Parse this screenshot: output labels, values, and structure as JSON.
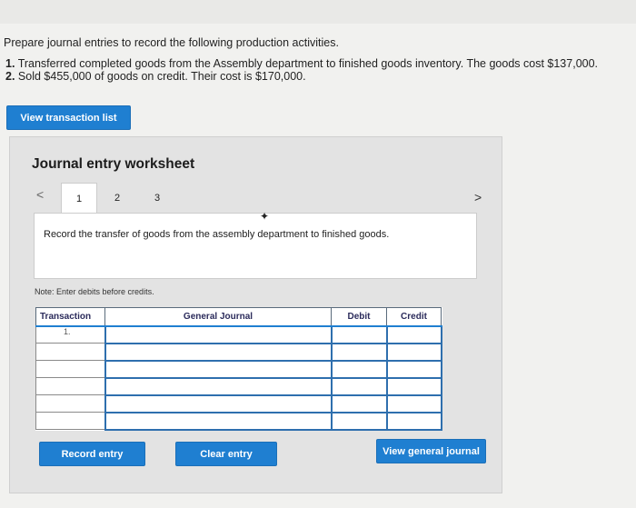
{
  "prompt": "Prepare journal entries to record the following production activities.",
  "items": [
    {
      "num": "1.",
      "text": "Transferred completed goods from the Assembly department to finished goods inventory. The goods cost $137,000."
    },
    {
      "num": "2.",
      "text": "Sold $455,000 of goods on credit. Their cost is $170,000."
    }
  ],
  "buttons": {
    "view_transaction_list": "View transaction list",
    "record_entry": "Record entry",
    "clear_entry": "Clear entry",
    "view_general_journal": "View general journal"
  },
  "worksheet": {
    "title": "Journal entry worksheet",
    "nav_prev": "<",
    "nav_next": ">",
    "tabs": [
      "1",
      "2",
      "3"
    ],
    "description": "Record the transfer of goods from the assembly department to finished goods.",
    "note": "Note: Enter debits before credits."
  },
  "table": {
    "headers": [
      "Transaction",
      "General Journal",
      "Debit",
      "Credit"
    ],
    "transaction": "1."
  },
  "colors": {
    "accent": "#1f7fd1",
    "worksheet_bg": "#e3e3e3"
  }
}
